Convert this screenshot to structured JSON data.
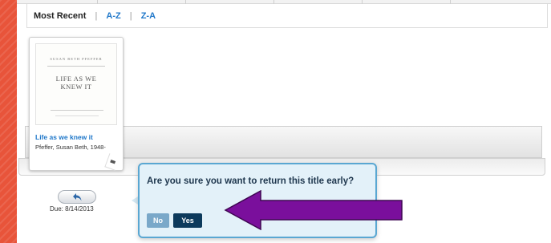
{
  "sort_bar": {
    "current": "Most Recent",
    "separator": "|",
    "options": [
      "A-Z",
      "Z-A"
    ]
  },
  "book": {
    "cover": {
      "author": "SUSAN BETH PFEFFER",
      "title_line1": "LIFE AS WE",
      "title_line2": "KNEW IT"
    },
    "title": "Life as we knew it",
    "author": "Pfeffer, Susan Beth, 1948-",
    "format_icon": "book-format-icon"
  },
  "loan": {
    "return_icon": "return-arrow-icon",
    "due": "Due: 8/14/2013"
  },
  "dialog": {
    "question": "Are you sure you want to return this title early?",
    "no_label": "No",
    "yes_label": "Yes"
  },
  "annotation": {
    "arrow_color": "#7a0f9c"
  },
  "colors": {
    "background": "#e8543a",
    "link": "#1f77c9",
    "dialog_bg": "#e3f1f9",
    "dialog_border": "#5aa7d2",
    "yes_button": "#0d3a5c",
    "no_button": "#7aa8c9"
  }
}
